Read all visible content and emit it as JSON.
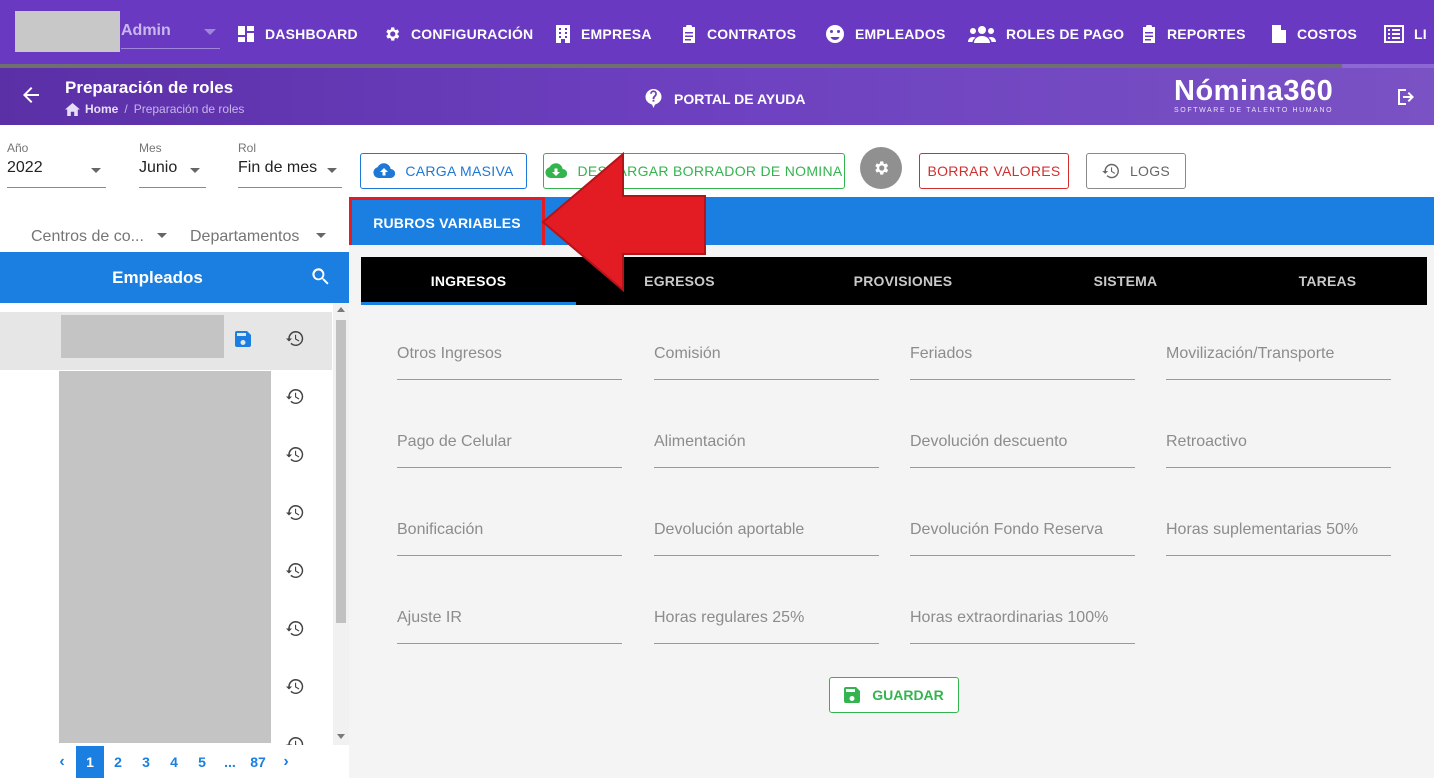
{
  "topnav": {
    "user": "Admin",
    "items": [
      {
        "label": "DASHBOARD",
        "icon": "dashboard-icon"
      },
      {
        "label": "CONFIGURACIÓN",
        "icon": "gear-icon"
      },
      {
        "label": "EMPRESA",
        "icon": "building-icon"
      },
      {
        "label": "CONTRATOS",
        "icon": "clipboard-icon"
      },
      {
        "label": "EMPLEADOS",
        "icon": "face-icon"
      },
      {
        "label": "ROLES DE PAGO",
        "icon": "users-icon"
      },
      {
        "label": "REPORTES",
        "icon": "clipboard-icon"
      },
      {
        "label": "COSTOS",
        "icon": "invoice-icon"
      },
      {
        "label": "LI",
        "icon": "list-icon"
      }
    ]
  },
  "header": {
    "title": "Preparación de roles",
    "breadcrumb_home": "Home",
    "breadcrumb_separator": "/",
    "breadcrumb_current": "Preparación de roles",
    "help_label": "PORTAL DE AYUDA",
    "brand_name": "Nómina360",
    "brand_tagline": "SOFTWARE DE TALENTO HUMANO"
  },
  "filters": {
    "year_label": "Año",
    "year_value": "2022",
    "month_label": "Mes",
    "month_value": "Junio",
    "rol_label": "Rol",
    "rol_value": "Fin de mes",
    "cost_center_placeholder": "Centros de co...",
    "departments_placeholder": "Departamentos"
  },
  "toolbar": {
    "bulk_upload": "CARGA MASIVA",
    "download_draft": "DESCARGAR BORRADOR DE NOMINA",
    "clear_values": "BORRAR VALORES",
    "logs": "LOGS"
  },
  "main_tab": "RUBROS VARIABLES",
  "employees": {
    "title": "Empleados",
    "pagination": [
      "1",
      "2",
      "3",
      "4",
      "5",
      "...",
      "87"
    ],
    "active_page": "1"
  },
  "subtabs": [
    "INGRESOS",
    "EGRESOS",
    "PROVISIONES",
    "SISTEMA",
    "TAREAS"
  ],
  "active_subtab": "INGRESOS",
  "fields": [
    "Otros Ingresos",
    "Comisión",
    "Feriados",
    "Movilización/Transporte",
    "Pago de Celular",
    "Alimentación",
    "Devolución descuento",
    "Retroactivo",
    "Bonificación",
    "Devolución aportable",
    "Devolución Fondo Reserva",
    "Horas suplementarias 50%",
    "Ajuste IR",
    "Horas regulares 25%",
    "Horas extraordinarias 100%"
  ],
  "save_label": "GUARDAR",
  "colors": {
    "nav_purple": "#6a39c2",
    "accent_blue": "#1a7fe0",
    "highlight_red": "#e31b23",
    "success_green": "#34b44f"
  }
}
